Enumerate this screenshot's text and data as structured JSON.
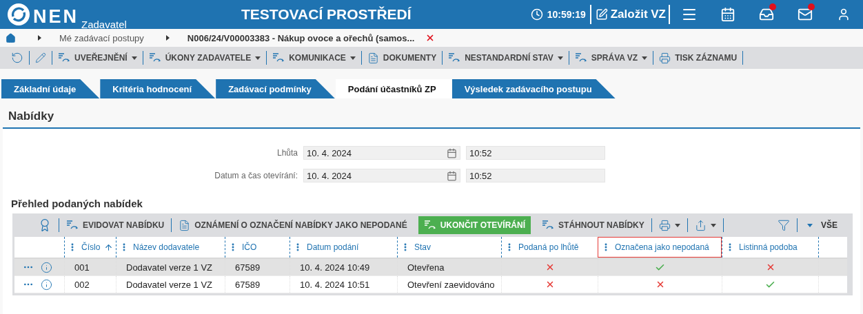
{
  "header": {
    "logo": "NEN",
    "role": "Zadavatel",
    "title": "TESTOVACÍ PROSTŘEDÍ",
    "time": "10:59:19",
    "create_label": "Založit VZ",
    "icons": [
      {
        "kind": "menu",
        "notification": false
      },
      {
        "kind": "calendar",
        "notification": false
      },
      {
        "kind": "inbox",
        "notification": true
      },
      {
        "kind": "mail",
        "notification": true
      },
      {
        "kind": "user",
        "notification": false
      }
    ]
  },
  "breadcrumb": [
    "Mé zadávací postupy",
    "N006/24/V00003383 - Nákup ovoce a ořechů (samos..."
  ],
  "toolbar": [
    {
      "kind": "refresh"
    },
    {
      "kind": "edit"
    },
    {
      "kind": "flow",
      "label": "UVEŘEJNĚNÍ",
      "dropdown": true
    },
    {
      "kind": "flow",
      "label": "ÚKONY ZADAVATELE",
      "dropdown": true
    },
    {
      "kind": "flow",
      "label": "KOMUNIKACE",
      "dropdown": true
    },
    {
      "kind": "document",
      "label": "DOKUMENTY",
      "dropdown": false
    },
    {
      "kind": "flow",
      "label": "NESTANDARDNÍ STAV",
      "dropdown": true
    },
    {
      "kind": "flow",
      "label": "SPRÁVA VZ",
      "dropdown": true
    },
    {
      "kind": "print",
      "label": "TISK ZÁZNAMU",
      "dropdown": false
    }
  ],
  "tabs": [
    {
      "label": "Základní údaje",
      "selected": false
    },
    {
      "label": "Kritéria hodnocení",
      "selected": false
    },
    {
      "label": "Zadávací podmínky",
      "selected": false
    },
    {
      "label": "Podání účastníků ZP",
      "selected": true
    },
    {
      "label": "Výsledek zadávacího postupu",
      "selected": false
    }
  ],
  "section_title": "Nabídky",
  "fields": [
    {
      "label": "Lhůta",
      "date": "10. 4. 2024",
      "time": "10:52"
    },
    {
      "label": "Datum a čas otevírání:",
      "date": "10. 4. 2024",
      "time": "10:52"
    }
  ],
  "grid": {
    "title": "Přehled podaných nabídek",
    "toolbar": [
      {
        "kind": "award"
      },
      {
        "kind": "flow",
        "label": "EVIDOVAT NABÍDKU"
      },
      {
        "kind": "document",
        "label": "OZNÁMENÍ O OZNAČENÍ NABÍDKY JAKO NEPODANÉ"
      },
      {
        "kind": "primary",
        "label": "UKONČIT OTEVÍRÁNÍ"
      },
      {
        "kind": "flow",
        "label": "STÁHNOUT NABÍDKY"
      },
      {
        "kind": "print_menu"
      },
      {
        "kind": "export_menu"
      }
    ],
    "filter_label": "VŠE",
    "columns": [
      {
        "label": "Číslo",
        "sorted": true,
        "focused": false
      },
      {
        "label": "Název dodavatele",
        "sorted": false,
        "focused": false
      },
      {
        "label": "IČO",
        "sorted": false,
        "focused": false
      },
      {
        "label": "Datum podání",
        "sorted": false,
        "focused": false
      },
      {
        "label": "Stav",
        "sorted": false,
        "focused": false
      },
      {
        "label": "Podaná po lhůtě",
        "sorted": false,
        "focused": false
      },
      {
        "label": "Označena jako nepodaná",
        "sorted": false,
        "focused": true
      },
      {
        "label": "Listinná podoba",
        "sorted": false,
        "focused": false
      }
    ],
    "rows": [
      {
        "selected": true,
        "number": "001",
        "supplier": "Dodavatel verze 1 VZ",
        "ico": "67589",
        "submitted": "10. 4. 2024 10:49",
        "status": "Otevřena",
        "late": false,
        "marked": true,
        "paper": false
      },
      {
        "selected": false,
        "number": "002",
        "supplier": "Dodavatel verze 1 VZ",
        "ico": "67589",
        "submitted": "10. 4. 2024 10:51",
        "status": "Otevření zaevidováno",
        "late": false,
        "marked": false,
        "paper": true
      }
    ]
  }
}
